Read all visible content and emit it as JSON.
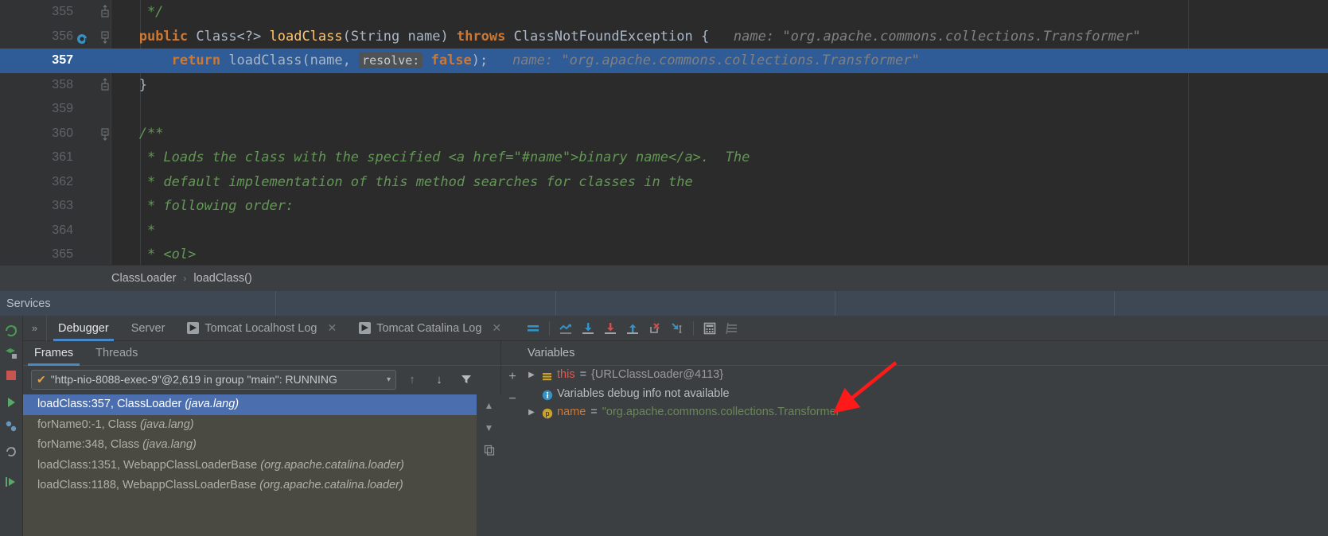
{
  "editor": {
    "lines": [
      {
        "num": "355",
        "fold": "end",
        "breakpoint": false,
        "highlight": false,
        "segments": [
          {
            "t": "    */",
            "c": "cmt"
          }
        ]
      },
      {
        "num": "356",
        "fold": "start",
        "breakpoint": true,
        "highlight": false,
        "segments": [
          {
            "t": "   ",
            "c": "id"
          },
          {
            "t": "public ",
            "c": "kw"
          },
          {
            "t": "Class<?> ",
            "c": "cls"
          },
          {
            "t": "loadClass",
            "c": "mth"
          },
          {
            "t": "(String name) ",
            "c": "id"
          },
          {
            "t": "throws ",
            "c": "kw"
          },
          {
            "t": "ClassNotFoundException {",
            "c": "id"
          },
          {
            "t": "   name: \"org.apache.commons.collections.Transformer\"",
            "c": "hint"
          }
        ]
      },
      {
        "num": "357",
        "fold": "none",
        "breakpoint": false,
        "highlight": true,
        "segments": [
          {
            "t": "       ",
            "c": "id"
          },
          {
            "t": "return ",
            "c": "kw"
          },
          {
            "t": "loadClass(name, ",
            "c": "id"
          },
          {
            "t": "resolve:",
            "c": "chip"
          },
          {
            "t": " ",
            "c": "id"
          },
          {
            "t": "false",
            "c": "kw"
          },
          {
            "t": ");",
            "c": "id"
          },
          {
            "t": "   name: \"org.apache.commons.collections.Transformer\"",
            "c": "hint"
          }
        ]
      },
      {
        "num": "358",
        "fold": "end",
        "breakpoint": false,
        "highlight": false,
        "segments": [
          {
            "t": "   }",
            "c": "id"
          }
        ]
      },
      {
        "num": "359",
        "fold": "none",
        "breakpoint": false,
        "highlight": false,
        "segments": [
          {
            "t": "",
            "c": "id"
          }
        ]
      },
      {
        "num": "360",
        "fold": "start",
        "breakpoint": false,
        "highlight": false,
        "segments": [
          {
            "t": "   /**",
            "c": "cmt"
          }
        ]
      },
      {
        "num": "361",
        "fold": "none",
        "breakpoint": false,
        "highlight": false,
        "segments": [
          {
            "t": "    * Loads the class with the specified <a href=\"#name\">binary name</a>.  The",
            "c": "cmt"
          }
        ]
      },
      {
        "num": "362",
        "fold": "none",
        "breakpoint": false,
        "highlight": false,
        "segments": [
          {
            "t": "    * default implementation of this method searches for classes in the",
            "c": "cmt"
          }
        ]
      },
      {
        "num": "363",
        "fold": "none",
        "breakpoint": false,
        "highlight": false,
        "segments": [
          {
            "t": "    * following order:",
            "c": "cmt"
          }
        ]
      },
      {
        "num": "364",
        "fold": "none",
        "breakpoint": false,
        "highlight": false,
        "segments": [
          {
            "t": "    *",
            "c": "cmt"
          }
        ]
      },
      {
        "num": "365",
        "fold": "none",
        "breakpoint": false,
        "highlight": false,
        "segments": [
          {
            "t": "    * <ol>",
            "c": "cmt"
          }
        ]
      }
    ]
  },
  "breadcrumb": {
    "items": [
      "ClassLoader",
      "loadClass()"
    ],
    "separator": "›"
  },
  "services_bar": {
    "title": "Services"
  },
  "tabs": {
    "overflow_label": "»",
    "items": [
      {
        "label": "Debugger",
        "active": true,
        "icon": null,
        "closable": false
      },
      {
        "label": "Server",
        "active": false,
        "icon": null,
        "closable": false
      },
      {
        "label": "Tomcat Localhost Log",
        "active": false,
        "icon": "run-icon",
        "closable": true
      },
      {
        "label": "Tomcat Catalina Log",
        "active": false,
        "icon": "run-icon",
        "closable": true
      }
    ],
    "close_glyph": "✕"
  },
  "debug_toolbar": {
    "buttons": [
      {
        "name": "mute-breakpoints-icon",
        "title": "Mute Breakpoints"
      },
      {
        "name": "show-execution-point-icon",
        "title": "Show Execution Point"
      },
      {
        "name": "step-over-icon",
        "title": "Step Over"
      },
      {
        "name": "step-into-icon",
        "title": "Step Into"
      },
      {
        "name": "step-out-icon",
        "title": "Step Out"
      },
      {
        "name": "force-step-into-icon",
        "title": "Force Step Into"
      },
      {
        "name": "run-to-cursor-icon",
        "title": "Run to Cursor"
      },
      {
        "name": "evaluate-expression-icon",
        "title": "Evaluate Expression"
      },
      {
        "name": "settings-icon",
        "title": "Settings"
      }
    ]
  },
  "frames_panel": {
    "subtabs": [
      {
        "label": "Frames",
        "active": true
      },
      {
        "label": "Threads",
        "active": false
      }
    ],
    "thread_selector": {
      "value": "\"http-nio-8088-exec-9\"@2,619 in group \"main\": RUNNING",
      "status_glyph": "✔",
      "arrow_glyph": "▾"
    },
    "nav_buttons": [
      {
        "name": "frame-up-button",
        "glyph": "↑"
      },
      {
        "name": "frame-down-button",
        "glyph": "↓"
      },
      {
        "name": "filter-frames-button",
        "glyph": "filter-icon"
      }
    ],
    "frames": [
      {
        "text": "loadClass:357, ClassLoader ",
        "pkg": "(java.lang)",
        "selected": true
      },
      {
        "text": "forName0:-1, Class ",
        "pkg": "(java.lang)",
        "selected": false
      },
      {
        "text": "forName:348, Class ",
        "pkg": "(java.lang)",
        "selected": false
      },
      {
        "text": "loadClass:1351, WebappClassLoaderBase ",
        "pkg": "(org.apache.catalina.loader)",
        "selected": false
      },
      {
        "text": "loadClass:1188, WebappClassLoaderBase ",
        "pkg": "(org.apache.catalina.loader)",
        "selected": false
      }
    ],
    "side_buttons": [
      {
        "name": "scroll-up-button",
        "glyph": "▲"
      },
      {
        "name": "scroll-down-button",
        "glyph": "▼"
      },
      {
        "name": "copy-stack-button",
        "glyph": "❐"
      }
    ]
  },
  "variables_panel": {
    "header": "Variables",
    "tool_buttons": [
      {
        "name": "add-watch-button",
        "glyph": "+"
      },
      {
        "name": "remove-watch-button",
        "glyph": "−"
      }
    ],
    "rows": [
      {
        "kind": "object",
        "twisty": "▶",
        "icon": "object-field-icon",
        "name": "this",
        "name_style": "this",
        "eq": "=",
        "value": "{URLClassLoader@4113}",
        "value_style": "plain"
      },
      {
        "kind": "info",
        "twisty": "",
        "icon": "info-icon",
        "name": "",
        "name_style": "none",
        "eq": "",
        "value": "Variables debug info not available",
        "value_style": "message"
      },
      {
        "kind": "param",
        "twisty": "▶",
        "icon": "parameter-icon",
        "name": "name",
        "name_style": "param",
        "eq": "=",
        "value": "\"org.apache.commons.collections.Transformer\"",
        "value_style": "string"
      }
    ]
  },
  "annotation": {
    "arrow_color": "#ff1a1a",
    "description": "red arrow pointing to the name variable"
  },
  "colors": {
    "editor_bg": "#2b2b2b",
    "panel_bg": "#3c3f41",
    "highlight_line": "#2f5b97",
    "selection_blue": "#4b6eaf",
    "services_bar": "#3e4754",
    "frames_list_bg": "#4a4a42",
    "accent_tab": "#4a88c7",
    "comment_green": "#629755",
    "keyword_orange": "#cc7832",
    "method_yellow": "#ffc66d",
    "string_green": "#6a8759",
    "this_red": "#e8564f"
  }
}
